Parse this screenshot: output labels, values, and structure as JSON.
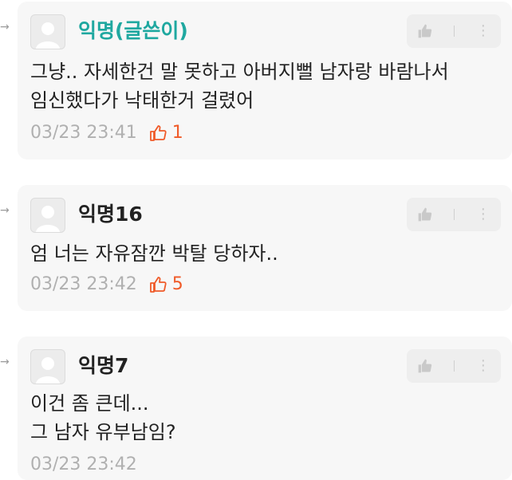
{
  "comments": [
    {
      "name": "익명(글쓴이)",
      "is_author": true,
      "text": "그냥.. 자세한건 말 못하고 아버지뻘 남자랑 바람나서\n임신했다가 낙태한거 걸렸어",
      "timestamp": "03/23 23:41",
      "likes": "1"
    },
    {
      "name": "익명16",
      "is_author": false,
      "text": "엄 너는 자유잠깐 박탈 당하자..",
      "timestamp": "03/23 23:42",
      "likes": "5"
    },
    {
      "name": "익명7",
      "is_author": false,
      "text": "이건 좀 큰데...\n그 남자 유부남임?",
      "timestamp": "03/23 23:42",
      "likes": ""
    }
  ],
  "icons": {
    "reply_arrow": "reply-arrow-icon",
    "avatar": "user-avatar-icon",
    "like": "thumbs-up-icon",
    "more": "more-vertical-icon"
  },
  "colors": {
    "author_name": "#1fa8a0",
    "like_accent": "#f05a28",
    "card_bg": "#f7f7f7",
    "timestamp": "#b0b0b0"
  }
}
